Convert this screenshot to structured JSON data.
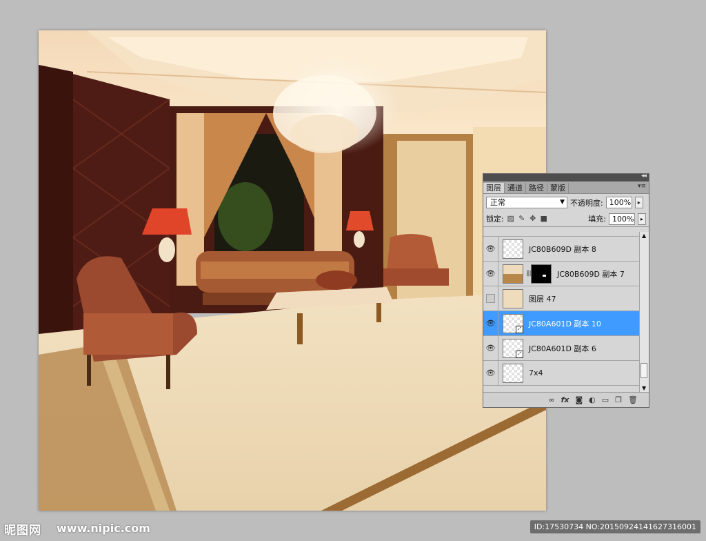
{
  "watermark": {
    "logo": "昵图网",
    "site": "www.nipic.com",
    "id_text": "ID:17530734 NO:20150924141627316001"
  },
  "panel": {
    "tabs": [
      {
        "label": "图层",
        "active": true
      },
      {
        "label": "通道",
        "active": false
      },
      {
        "label": "路径",
        "active": false
      },
      {
        "label": "蒙版",
        "active": false
      }
    ],
    "blend_mode": "正常",
    "opacity_label": "不透明度:",
    "opacity_value": "100%",
    "lock_label": "锁定:",
    "fill_label": "填充:",
    "fill_value": "100%",
    "layers": [
      {
        "name": "JC80B609D 副本 8",
        "visible": true,
        "thumb": "checker",
        "mask": false,
        "smart": false,
        "selected": false
      },
      {
        "name": "JC80B609D 副本 7",
        "visible": true,
        "thumb": "brown",
        "mask": true,
        "smart": false,
        "selected": false
      },
      {
        "name": "图层 47",
        "visible": false,
        "thumb": "tan",
        "mask": false,
        "smart": false,
        "selected": false
      },
      {
        "name": "JC80A601D 副本 10",
        "visible": true,
        "thumb": "checker",
        "mask": false,
        "smart": true,
        "selected": true
      },
      {
        "name": "JC80A601D 副本 6",
        "visible": true,
        "thumb": "checker",
        "mask": false,
        "smart": true,
        "selected": false
      },
      {
        "name": "7x4",
        "visible": true,
        "thumb": "checker",
        "mask": false,
        "smart": false,
        "selected": false
      }
    ],
    "footer_icons": [
      "link-icon",
      "fx-icon",
      "mask-icon",
      "adjustment-icon",
      "group-icon",
      "new-layer-icon",
      "trash-icon"
    ]
  },
  "colors": {
    "canvas_bg": "#bdbdbd",
    "selection": "#3f9bff",
    "panel_bg": "#d6d6d6"
  }
}
